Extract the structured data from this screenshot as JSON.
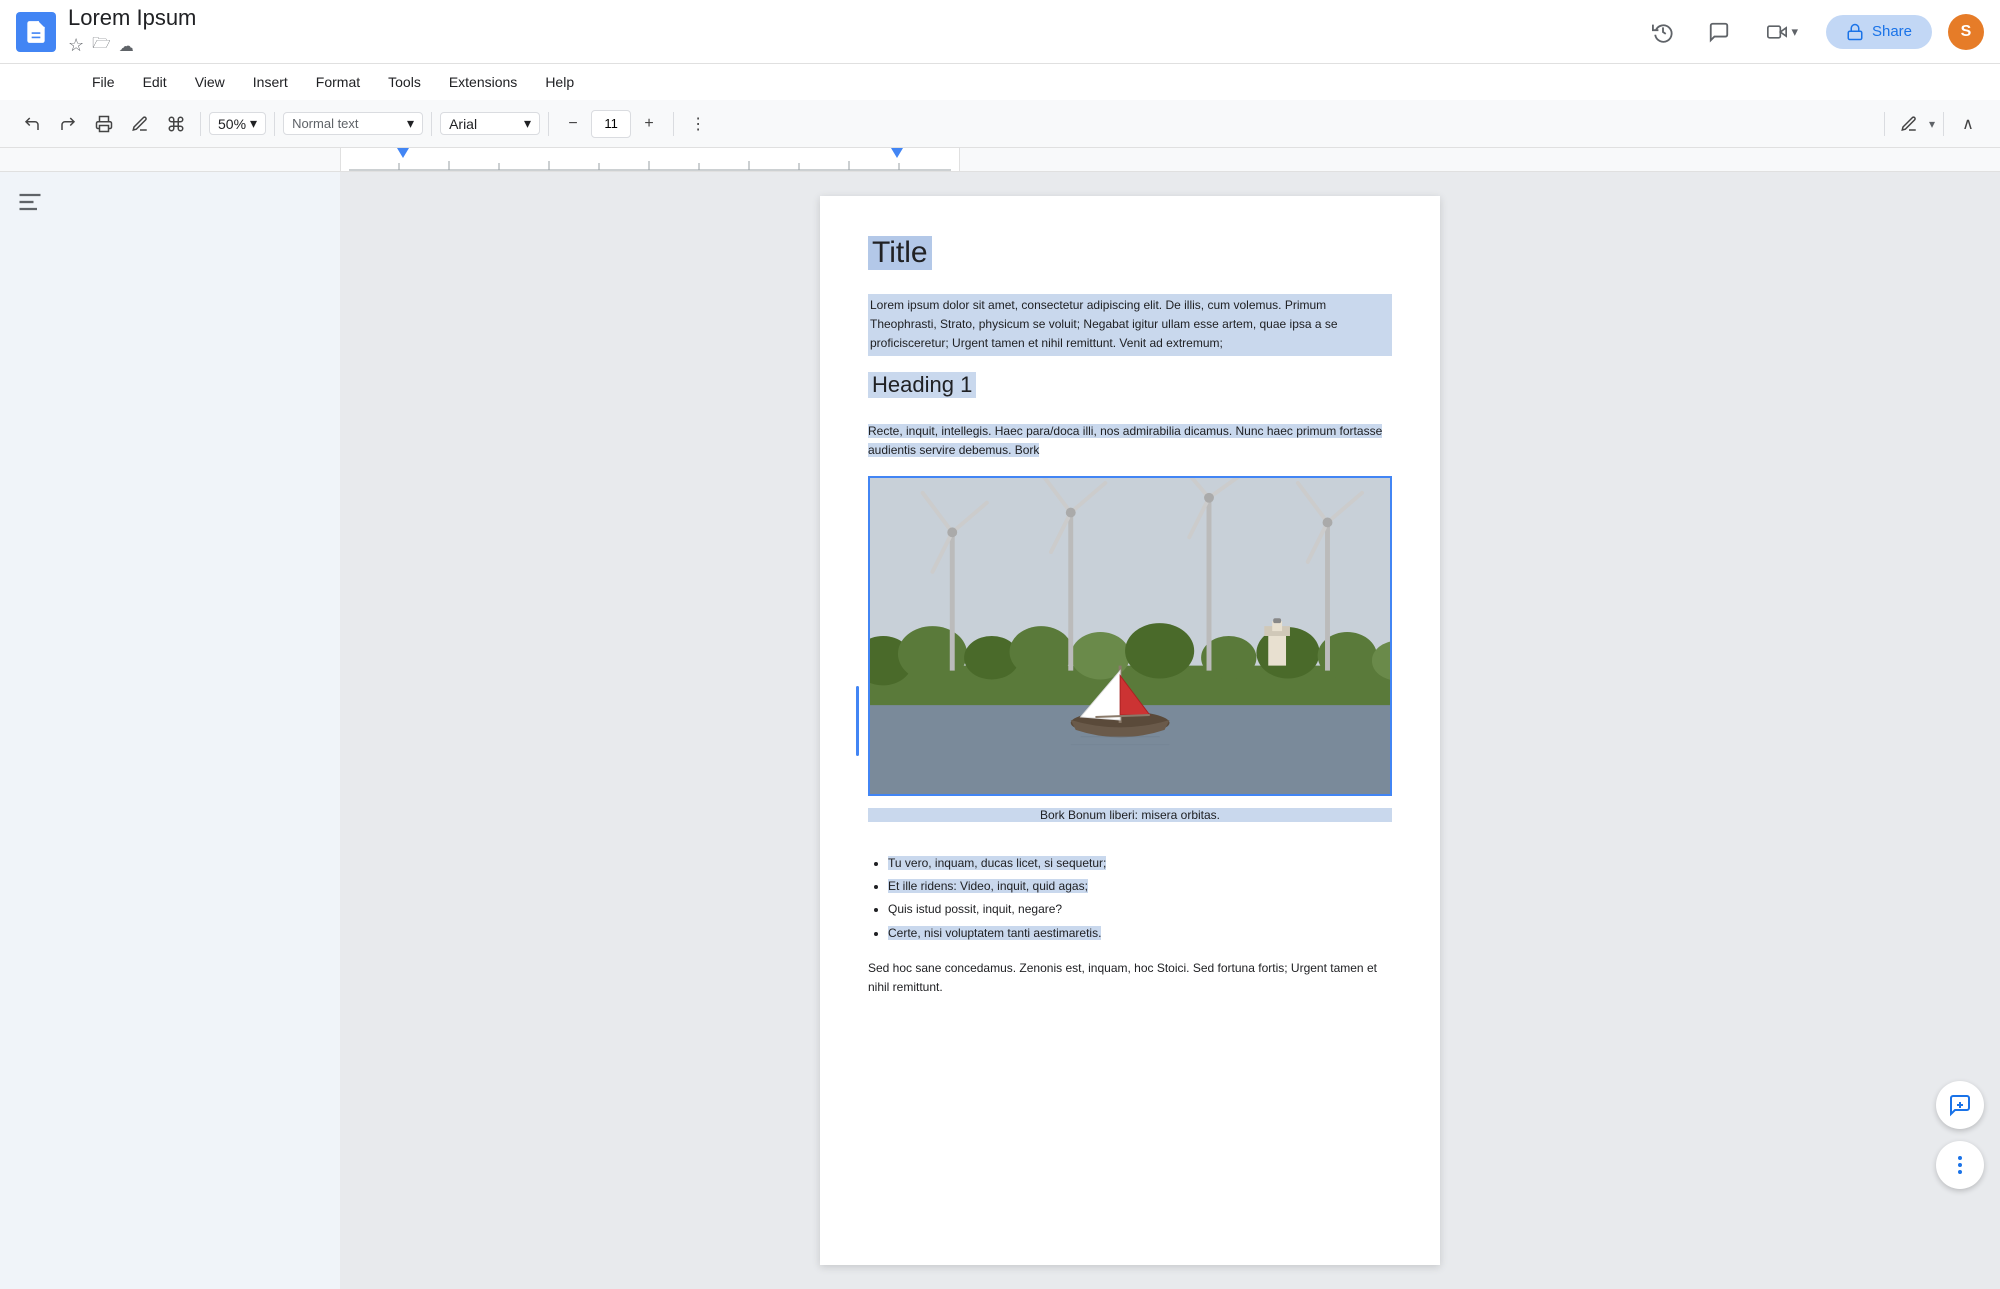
{
  "app": {
    "doc_title": "Lorem Ipsum",
    "doc_icon_color": "#4285f4"
  },
  "title_actions": {
    "star_icon": "★",
    "folder_icon": "🗁",
    "cloud_icon": "☁"
  },
  "top_right": {
    "history_icon": "⟳",
    "comments_icon": "💬",
    "meet_label": "▶",
    "share_label": "Share",
    "lock_icon": "🔒"
  },
  "menu": {
    "items": [
      "File",
      "Edit",
      "View",
      "Insert",
      "Format",
      "Tools",
      "Extensions",
      "Help"
    ]
  },
  "toolbar": {
    "undo_icon": "↩",
    "redo_icon": "↪",
    "print_icon": "🖶",
    "paint_format_icon": "✎",
    "zoom_value": "50%",
    "style_placeholder": "",
    "font_name": "Arial",
    "font_size": "11",
    "minus_icon": "−",
    "plus_icon": "+",
    "more_icon": "⋮",
    "edit_mode_icon": "✏",
    "collapse_icon": "∧"
  },
  "document": {
    "title": "Title",
    "paragraph1": "Lorem ipsum dolor sit amet, consectetur adipiscing elit. De illis, cum volemus. Primum Theophrasti, Strato, physicum se voluit; Negabat igitur ullam esse artem, quae ipsa a se proficisceretur; Urgent tamen et nihil remittunt. Venit ad extremum;",
    "heading1": "Heading 1",
    "paragraph2_sel": "Recte, inquit, intellegis. Haec para/doca illi, nos admirabilia dicamus. Nunc haec primum fortasse audientis servire debemus. Bork",
    "image_caption": "Bork Bonum liberi: misera orbitas.",
    "bullet_items": [
      "Tu vero, inquam, ducas licet, si sequetur;",
      "Et ille ridens: Video, inquit, quid agas;",
      "Quis istud possit, inquit, negare?",
      "Certe, nisi voluptatem tanti aestimaretis."
    ],
    "paragraph3": "Sed hoc sane concedamus. Zenonis est, inquam, hoc Stoici. Sed fortuna fortis; Urgent tamen et nihil remittunt."
  },
  "sidebar_float": {
    "add_comment_icon": "+💬",
    "more_icon": "⋮"
  }
}
